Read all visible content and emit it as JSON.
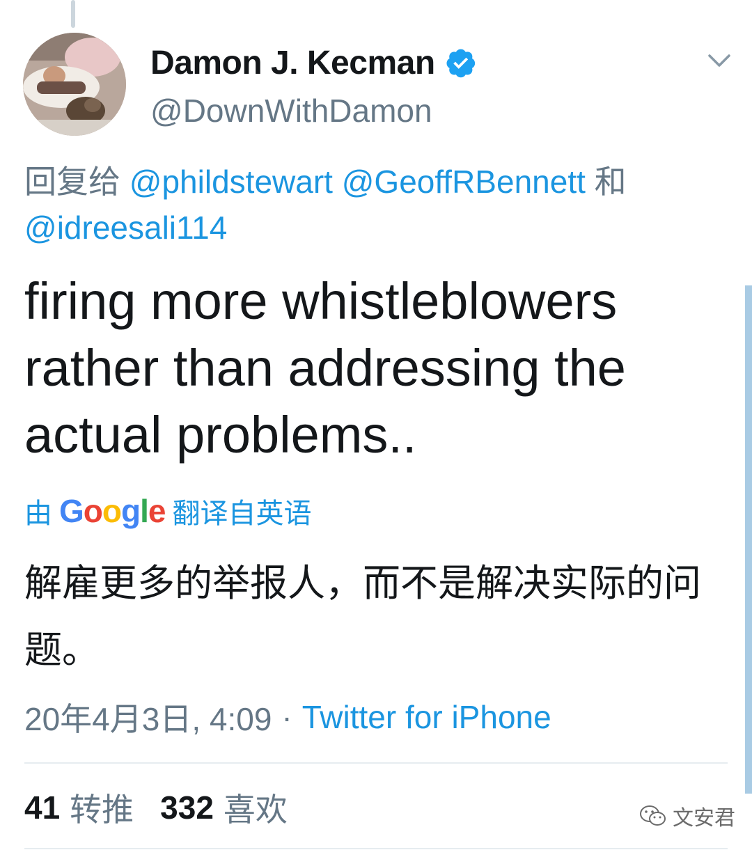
{
  "tweet": {
    "display_name": "Damon J. Kecman",
    "handle": "@DownWithDamon",
    "reply_prefix": "回复给",
    "reply_mentions": [
      "@phildstewart",
      "@GeoffRBennett",
      "@idreesali114"
    ],
    "reply_conjunction": "和",
    "text": "firing more whistleblowers rather than addressing the actual problems..",
    "translation": {
      "prefix": "由",
      "provider": "Google",
      "suffix": "翻译自英语",
      "text": "解雇更多的举报人，而不是解决实际的问题。"
    },
    "timestamp": "20年4月3日, 4:09",
    "separator": "·",
    "source": "Twitter for iPhone",
    "retweets_count": "41",
    "retweets_label": "转推",
    "likes_count": "332",
    "likes_label": "喜欢"
  },
  "watermark": {
    "text": "文安君",
    "icon": "wechat-icon"
  },
  "icons": {
    "verified": "verified-badge-icon",
    "menu": "chevron-down-icon"
  },
  "colors": {
    "link": "#1b95e0",
    "muted": "#657786",
    "text": "#14171a",
    "divider": "#e6ecf0"
  }
}
